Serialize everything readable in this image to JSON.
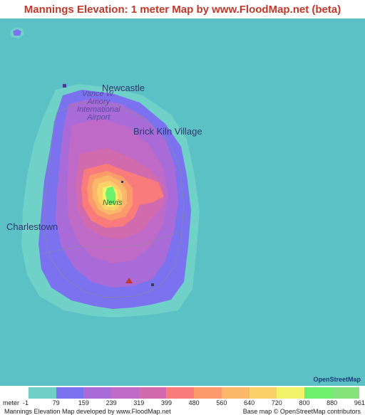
{
  "title": "Mannings Elevation: 1 meter Map by www.FloodMap.net (beta)",
  "places": {
    "newcastle": "Newcastle",
    "airport_line1": "Vance W.",
    "airport_line2": "Amory",
    "airport_line3": "International",
    "airport_line4": "Airport",
    "brick_kiln": "Brick Kiln Village",
    "charlestown": "Charlestown",
    "nevis": "Nevis"
  },
  "osm_logo": "OpenStreetMap",
  "legend": {
    "unit": "meter",
    "ticks": [
      "-1",
      "79",
      "159",
      "239",
      "319",
      "399",
      "480",
      "560",
      "640",
      "720",
      "800",
      "880",
      "961"
    ],
    "colors": [
      "#6fd1c7",
      "#7b72f0",
      "#a96bd8",
      "#c06ac8",
      "#d26aae",
      "#f97b7b",
      "#fb9a6a",
      "#fbb86a",
      "#fbd26a",
      "#f3f36a",
      "#6df06d",
      "#84e27a"
    ]
  },
  "footer": {
    "left": "Mannings Elevation Map developed by www.FloodMap.net",
    "right": "Base map © OpenStreetMap contributors"
  },
  "colors": {
    "sea": "#5bc1c5",
    "shore": "#6fd1c7",
    "title": "#c0392b"
  }
}
